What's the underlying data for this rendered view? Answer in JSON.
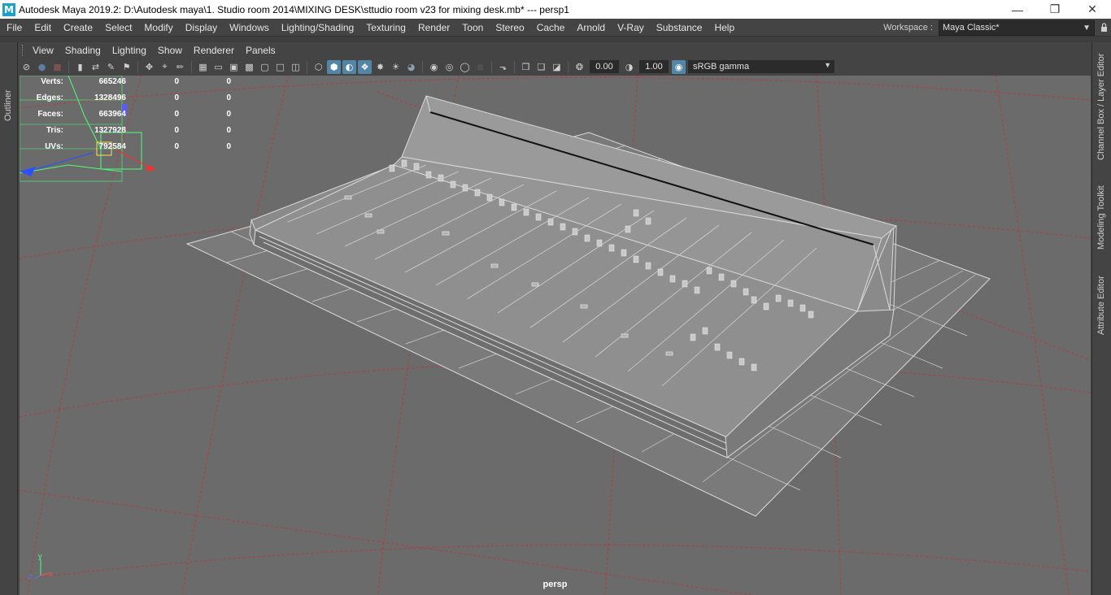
{
  "titlebar": {
    "app_icon": "M",
    "title": "Autodesk Maya 2019.2: D:\\Autodesk maya\\1. Studio room 2014\\MIXING DESK\\sttudio room v23 for mixing desk.mb*   ---   persp1",
    "minimize_icon": "minimize-icon",
    "restore_icon": "restore-icon",
    "close_icon": "close-icon"
  },
  "menubar": {
    "items": [
      "File",
      "Edit",
      "Create",
      "Select",
      "Modify",
      "Display",
      "Windows",
      "Lighting/Shading",
      "Texturing",
      "Render",
      "Toon",
      "Stereo",
      "Cache",
      "Arnold",
      "V-Ray",
      "Substance",
      "Help"
    ]
  },
  "workspace": {
    "label": "Workspace :",
    "value": "Maya Classic*"
  },
  "left_tab": {
    "label": "Outliner"
  },
  "right_tabs": {
    "items": [
      "Channel Box / Layer Editor",
      "Modeling Toolkit",
      "Attribute Editor"
    ]
  },
  "panel_menu": {
    "items": [
      "View",
      "Shading",
      "Lighting",
      "Show",
      "Renderer",
      "Panels"
    ]
  },
  "panel_toolbar": {
    "exposure": "0.00",
    "gamma": "1.00",
    "color_space": "sRGB gamma"
  },
  "hud": {
    "rows": [
      {
        "label": "Verts:",
        "value": "665246",
        "a": "0",
        "b": "0"
      },
      {
        "label": "Edges:",
        "value": "1328496",
        "a": "0",
        "b": "0"
      },
      {
        "label": "Faces:",
        "value": "663964",
        "a": "0",
        "b": "0"
      },
      {
        "label": "Tris:",
        "value": "1327928",
        "a": "0",
        "b": "0"
      },
      {
        "label": "UVs:",
        "value": "792584",
        "a": "0",
        "b": "0"
      }
    ]
  },
  "viewport": {
    "camera_label": "persp",
    "background_color": "#6b6b6b",
    "grid_color": "#b83a3a",
    "wire_color": "#d9d9d9",
    "axis": {
      "x": "x",
      "y": "y",
      "z": "z"
    }
  }
}
